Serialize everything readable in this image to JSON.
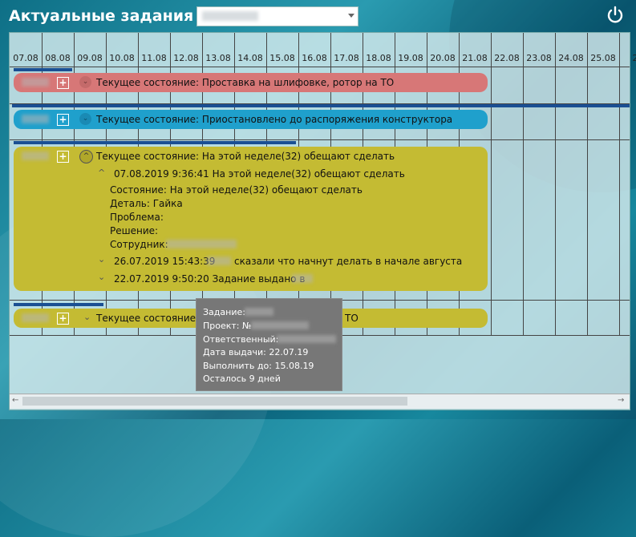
{
  "header": {
    "title": "Актуальные задания"
  },
  "dates": [
    "07.08",
    "08.08",
    "09.08",
    "10.08",
    "11.08",
    "12.08",
    "13.08",
    "14.08",
    "15.08",
    "16.08",
    "17.08",
    "18.08",
    "19.08",
    "20.08",
    "21.08",
    "22.08",
    "23.08",
    "24.08",
    "25.08",
    "2"
  ],
  "tasks": [
    {
      "color": "#d77777",
      "state": "Текущее состояние: Проставка на шлифовке, ротор на ТО"
    },
    {
      "color": "#1fa0cc",
      "state": "Текущее состояние: Приостановлено до распоряжения конструктора"
    },
    {
      "color": "#c4bb33",
      "state": "Текущее состояние: На этой неделе(32) обещают сделать",
      "history": [
        {
          "text": "07.08.2019 9:36:41 На этой неделе(32) обещают сделать"
        },
        {
          "text": "26.07.2019 15:43:39",
          "text2": "сказали что начнут делать в начале августа"
        },
        {
          "text": "22.07.2019 9:50:20 Задание выдано в"
        }
      ],
      "details": [
        "Состояние: На этой неделе(32) обещают сделать",
        "Деталь: Гайка",
        "Проблема:",
        "Решение:",
        "Сотрудник:"
      ]
    },
    {
      "color": "#c4bb33",
      "state": "Текущее состояние: ",
      "state_end": "ТО"
    }
  ],
  "tooltip": {
    "lines": [
      "Задание:",
      "Проект: №",
      "Ответственный:",
      "Дата выдачи: 22.07.19",
      "Выполнить до: 15.08.19",
      "Осталось 9 дней"
    ]
  },
  "icons": {
    "power": "power-icon",
    "plus": "plus-icon",
    "chevron": "chevron-icon"
  }
}
